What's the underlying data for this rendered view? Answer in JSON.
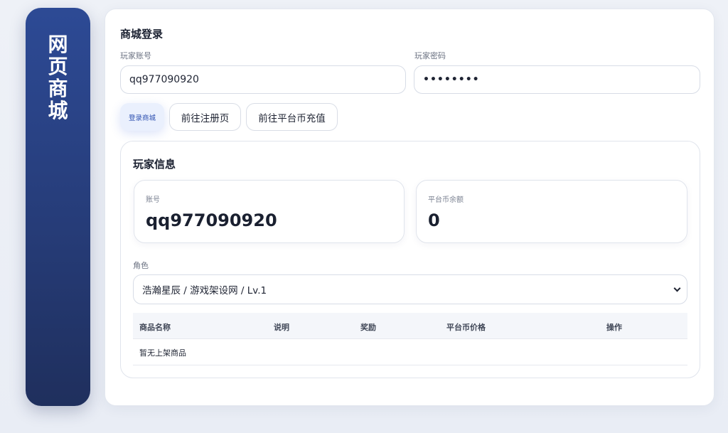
{
  "sidebar": {
    "title_chars": [
      "网",
      "页",
      "商",
      "城"
    ]
  },
  "login": {
    "title": "商城登录",
    "account_label": "玩家账号",
    "account_value": "qq977090920",
    "password_label": "玩家密码",
    "password_value": "••••••••"
  },
  "buttons": {
    "login": "登录商城",
    "register": "前往注册页",
    "recharge": "前往平台币充值"
  },
  "player_info": {
    "title": "玩家信息",
    "account_label": "账号",
    "account_value": "qq977090920",
    "balance_label": "平台币余额",
    "balance_value": "0"
  },
  "role": {
    "label": "角色",
    "selected": "浩瀚星辰 / 游戏架设网 / Lv.1"
  },
  "goods_table": {
    "columns": [
      "商品名称",
      "说明",
      "奖励",
      "平台币价格",
      "操作"
    ],
    "empty_text": "暂无上架商品"
  },
  "colors": {
    "sidebar": "#263c78",
    "primary_button_bg": "#eaf0fd",
    "primary_button_text": "#2c4fb0"
  }
}
